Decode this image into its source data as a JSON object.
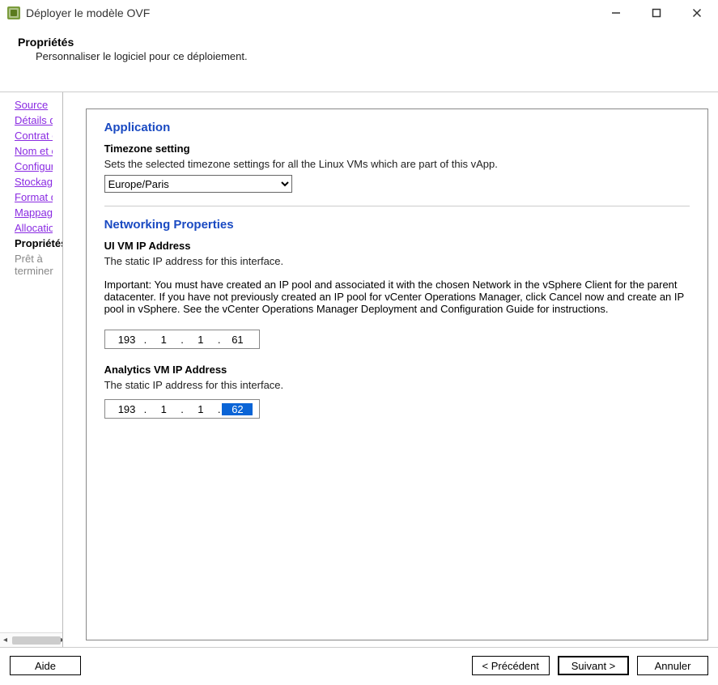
{
  "window": {
    "title": "Déployer le modèle OVF"
  },
  "header": {
    "heading": "Propriétés",
    "subheading": "Personnaliser le logiciel pour ce déploiement."
  },
  "sidebar": {
    "items": [
      {
        "label": "Source",
        "state": "visited"
      },
      {
        "label": "Détails de modèle OVF",
        "state": "visited"
      },
      {
        "label": "Contrat de Licence Utilisateur F",
        "state": "visited"
      },
      {
        "label": "Nom et emplacement",
        "state": "visited"
      },
      {
        "label": "Configuration de déploiement",
        "state": "visited"
      },
      {
        "label": "Stockage",
        "state": "visited"
      },
      {
        "label": "Format de disque",
        "state": "visited"
      },
      {
        "label": "Mappage de réseau",
        "state": "visited"
      },
      {
        "label": "Allocation d'adresse IP",
        "state": "visited"
      },
      {
        "label": "Propriétés",
        "state": "current"
      },
      {
        "label": "Prêt à terminer",
        "state": "future"
      }
    ]
  },
  "panel": {
    "application": {
      "title": "Application",
      "timezone": {
        "label": "Timezone setting",
        "desc": "Sets the selected timezone settings for all the Linux VMs which are part of this vApp.",
        "value": "Europe/Paris"
      }
    },
    "networking": {
      "title": "Networking Properties",
      "ui_vm": {
        "label": "UI VM IP Address",
        "desc": "The static IP address for this interface.",
        "note": "Important: You must have created an IP pool and associated it with the chosen Network in the vSphere Client for the parent datacenter. If you have not previously created an IP pool for vCenter Operations Manager, click Cancel now and create an IP pool in vSphere. See the vCenter Operations Manager Deployment and Configuration Guide for instructions.",
        "ip": {
          "o1": "193",
          "o2": "1",
          "o3": "1",
          "o4": "61"
        }
      },
      "analytics_vm": {
        "label": "Analytics VM IP Address",
        "desc": "The static IP address for this interface.",
        "ip": {
          "o1": "193",
          "o2": "1",
          "o3": "1",
          "o4": "62"
        }
      }
    }
  },
  "footer": {
    "help": "Aide",
    "back": "< Précédent",
    "next": "Suivant >",
    "cancel": "Annuler"
  }
}
